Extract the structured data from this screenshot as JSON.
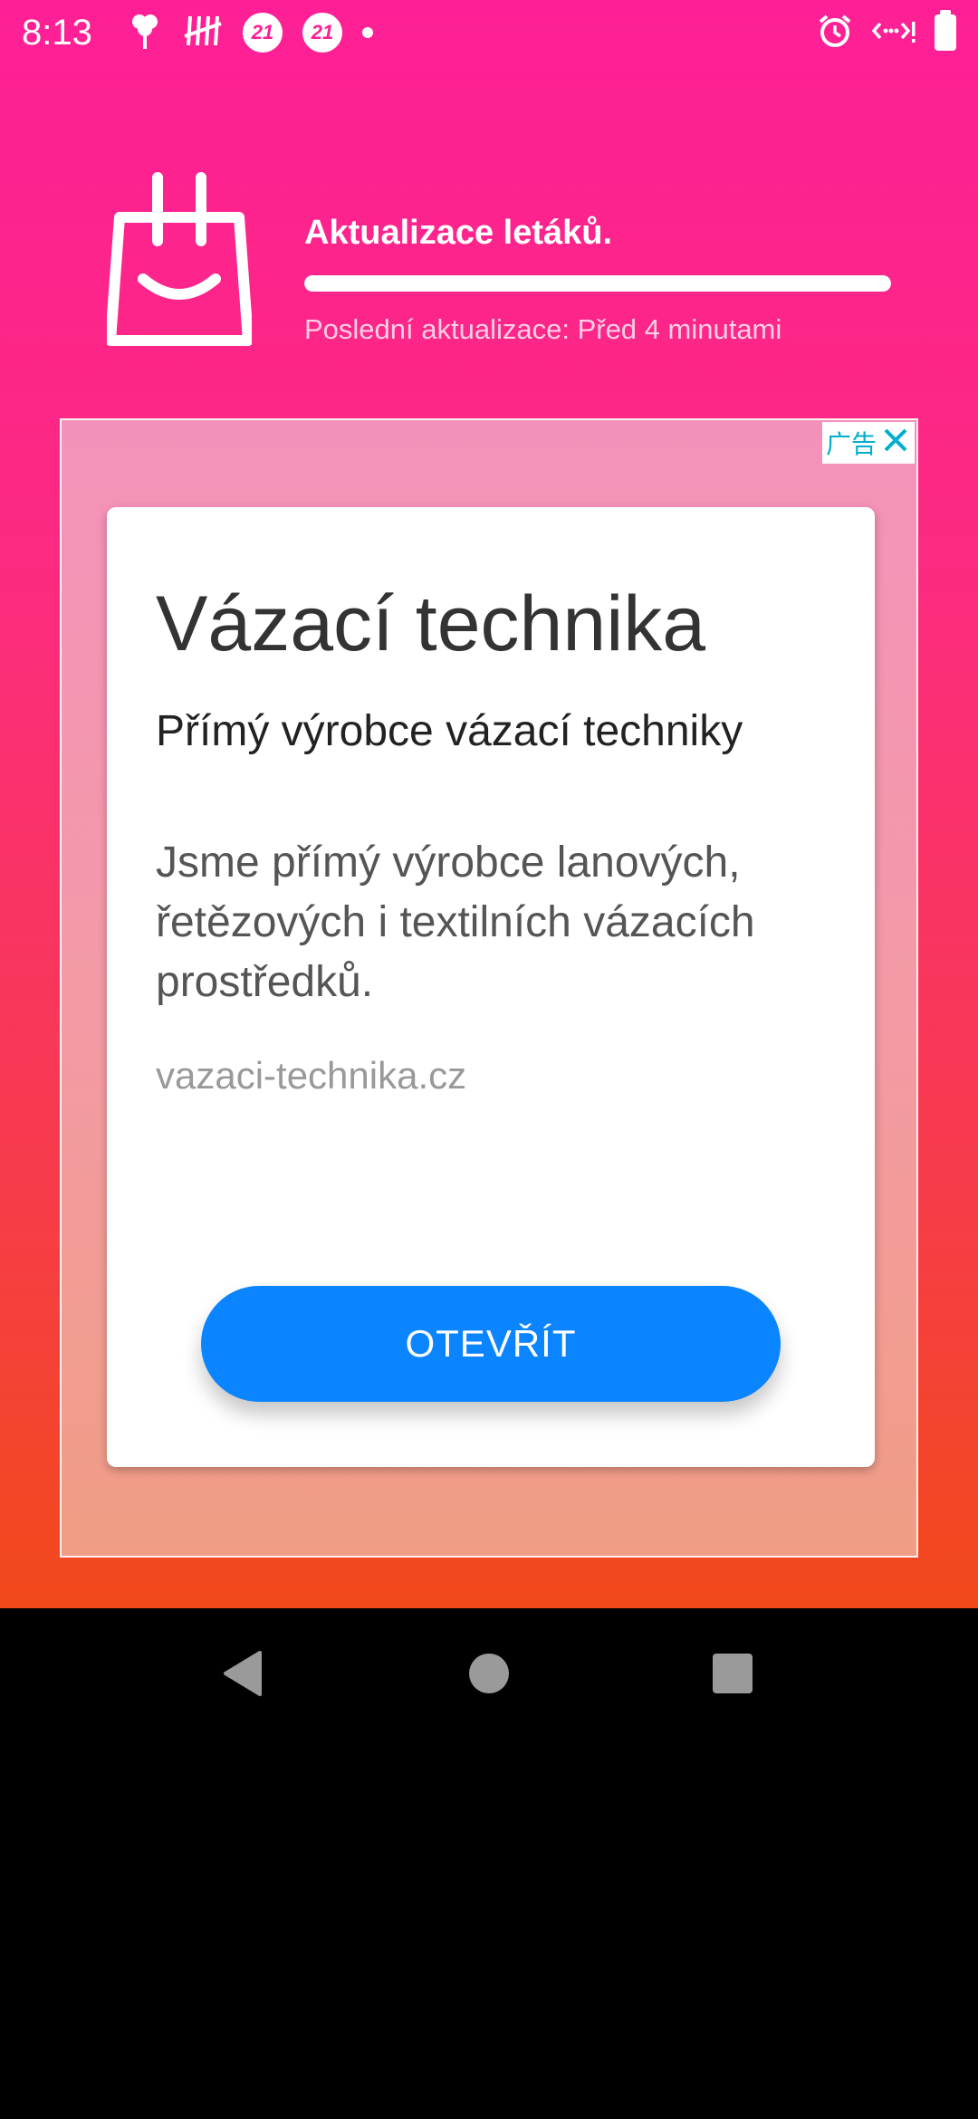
{
  "status_bar": {
    "time": "8:13",
    "notification_badges": [
      "21",
      "21"
    ],
    "icons": [
      "bouquet-icon",
      "tally-icon",
      "badge-21-icon",
      "badge-21-icon",
      "dot-icon",
      "alarm-icon",
      "data-saver-icon",
      "battery-icon"
    ]
  },
  "header": {
    "title": "Aktualizace letáků.",
    "progress_fraction": 1.0,
    "last_update": "Poslední aktualizace: Před 4 minutami",
    "logo_icon": "shopping-bag-smile-icon"
  },
  "ad": {
    "badge_label": "广告",
    "close_icon": "close-icon",
    "headline": "Vázací technika",
    "subheadline": "Přímý výrobce vázací techniky",
    "description": "Jsme přímý výrobce lanových, řetězových i textilních vázacích prostředků.",
    "url": "vazaci-technika.cz",
    "cta_label": "OTEVŘÍT",
    "cta_color": "#0a84ff"
  },
  "nav_bar": {
    "icons": [
      "back-icon",
      "home-icon",
      "recents-icon"
    ]
  },
  "colors": {
    "gradient_top": "#fe1f96",
    "gradient_bottom": "#f2491a",
    "ad_badge_text": "#00aecd"
  }
}
